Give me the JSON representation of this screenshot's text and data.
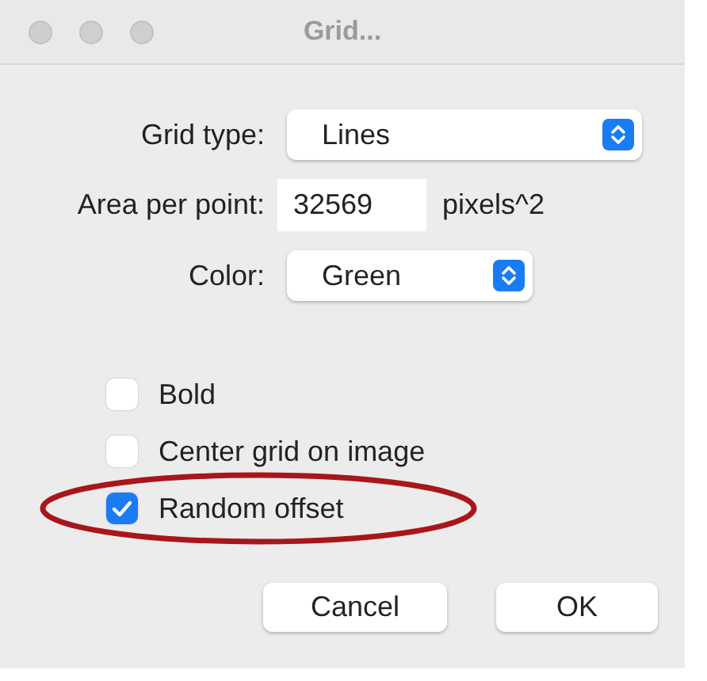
{
  "window": {
    "title": "Grid..."
  },
  "fields": [
    {
      "kind": "select",
      "label": "Grid type:",
      "value": "Lines"
    },
    {
      "kind": "text",
      "label": "Area per point:",
      "value": "32569",
      "unit": "pixels^2"
    },
    {
      "kind": "select",
      "label": "Color:",
      "value": "Green"
    }
  ],
  "checkboxes": [
    {
      "label": "Bold",
      "checked": false,
      "circled": false
    },
    {
      "label": "Center grid on image",
      "checked": false,
      "circled": false
    },
    {
      "label": "Random offset",
      "checked": true,
      "circled": true
    }
  ],
  "buttons": [
    "Cancel",
    "OK"
  ]
}
